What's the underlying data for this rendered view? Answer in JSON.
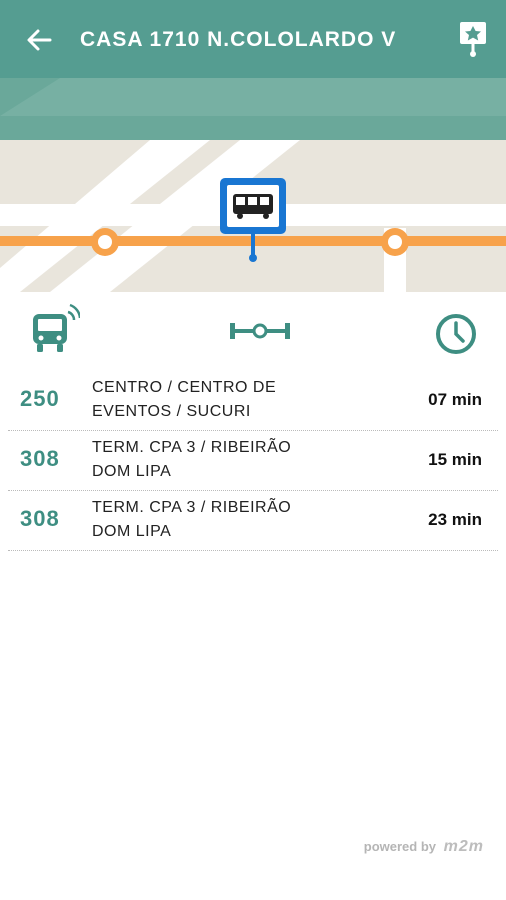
{
  "appbar": {
    "title": "CASA 1710 N.COLOLARDO V",
    "back_icon": "arrow-left-icon",
    "favorite_icon": "pin-star-icon"
  },
  "colors": {
    "appbar": "#559D91",
    "accent": "#3E8E82",
    "route_line": "#F7A24B",
    "stop_marker": "#1976D2",
    "map_ground": "#E9E5DC"
  },
  "header_icons": {
    "bus": "bus-signal-icon",
    "distance": "distance-icon",
    "clock": "clock-icon"
  },
  "arrivals": [
    {
      "line": "250",
      "destination_1": "CENTRO / CENTRO DE",
      "destination_2": "EVENTOS / SUCURI",
      "eta": "07 min"
    },
    {
      "line": "308",
      "destination_1": "TERM. CPA 3 / RIBEIRÃO",
      "destination_2": "DOM LIPA",
      "eta": "15 min"
    },
    {
      "line": "308",
      "destination_1": "TERM. CPA 3 / RIBEIRÃO",
      "destination_2": "DOM LIPA",
      "eta": "23 min"
    }
  ],
  "footer": {
    "powered_by": "powered by",
    "brand": "m2m"
  }
}
